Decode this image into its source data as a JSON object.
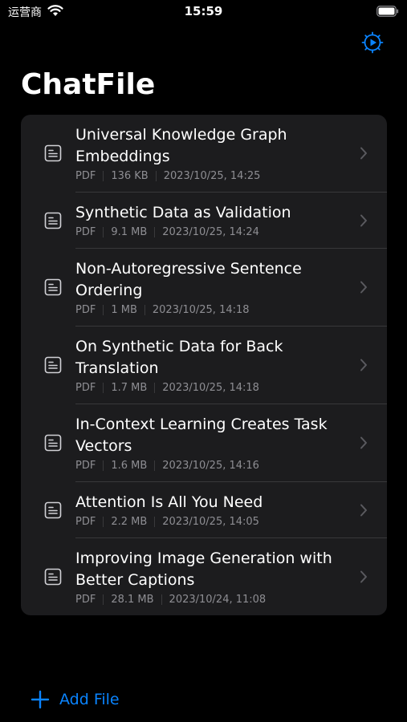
{
  "status_bar": {
    "carrier": "运营商",
    "time": "15:59"
  },
  "header": {
    "title": "ChatFile"
  },
  "files": [
    {
      "title": "Universal Knowledge Graph Embeddings",
      "type": "PDF",
      "size": "136 KB",
      "date": "2023/10/25, 14:25"
    },
    {
      "title": "Synthetic Data as Validation",
      "type": "PDF",
      "size": "9.1 MB",
      "date": "2023/10/25, 14:24"
    },
    {
      "title": "Non-Autoregressive Sentence Ordering",
      "type": "PDF",
      "size": "1 MB",
      "date": "2023/10/25, 14:18"
    },
    {
      "title": "On Synthetic Data for Back Translation",
      "type": "PDF",
      "size": "1.7 MB",
      "date": "2023/10/25, 14:18"
    },
    {
      "title": "In-Context Learning Creates Task Vectors",
      "type": "PDF",
      "size": "1.6 MB",
      "date": "2023/10/25, 14:16"
    },
    {
      "title": "Attention Is All You Need",
      "type": "PDF",
      "size": "2.2 MB",
      "date": "2023/10/25, 14:05"
    },
    {
      "title": "Improving Image Generation with Better Captions",
      "type": "PDF",
      "size": "28.1 MB",
      "date": "2023/10/24, 11:08"
    }
  ],
  "footer": {
    "add_label": "Add File"
  },
  "colors": {
    "accent": "#0a84ff",
    "background": "#000000",
    "card": "#1c1c1e",
    "secondary_text": "#8e8e93"
  },
  "icons": {
    "settings": "gear-play-icon",
    "row_icon": "document-icon",
    "row_disclosure": "chevron-right-icon",
    "add": "plus-icon"
  }
}
